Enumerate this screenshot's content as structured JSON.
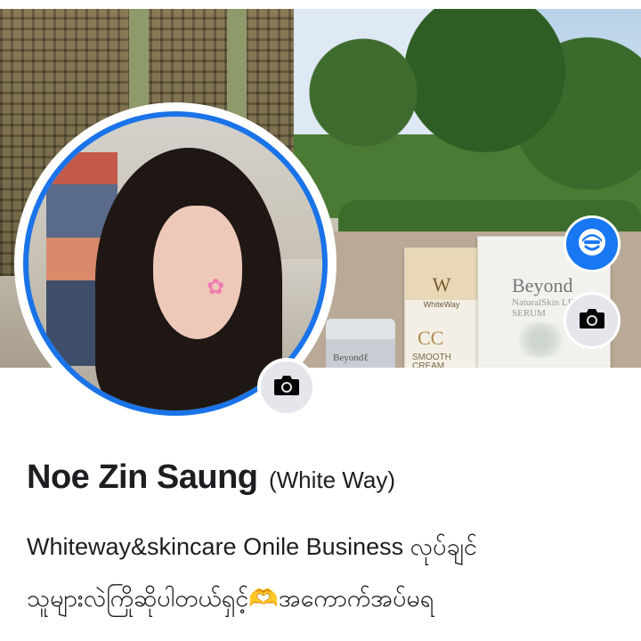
{
  "profile": {
    "name": "Noe Zin Saung",
    "alternate_name": "(White Way)",
    "bio_lines": [
      "Whiteway&skincare   Onile Business လုပ်ချင်",
      "သူများလဲကြိုဆိုပါတယ်ရှင့်🫶အကောက်အပ်မရ"
    ]
  },
  "cover": {
    "product_w_logo": "W",
    "product_w_brand": "WhiteWay",
    "product_w_name": "CC",
    "product_w_desc": "SMOOTH CREAM",
    "product_b_brand": "Beyond",
    "product_b_sub": "NaturalSkin LIFTING SERUM",
    "jar_label": "Beyondℓ"
  },
  "buttons": {
    "avatar_icon": "avatar-shortcut-icon",
    "cover_camera_icon": "camera-icon",
    "profile_camera_icon": "camera-icon"
  },
  "colors": {
    "accent": "#1877f2",
    "profile_ring": "#1a73e8",
    "button_gray": "#e4e6eb"
  }
}
